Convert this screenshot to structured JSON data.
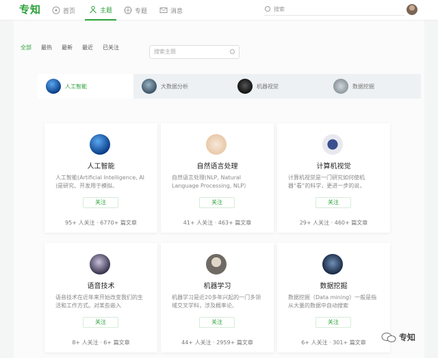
{
  "header": {
    "logo": "专知",
    "nav": [
      {
        "label": "首页",
        "icon": "home-icon"
      },
      {
        "label": "主题",
        "icon": "person-icon"
      },
      {
        "label": "专题",
        "icon": "globe-icon"
      },
      {
        "label": "消息",
        "icon": "mail-icon"
      }
    ],
    "search_placeholder": "搜索"
  },
  "filters": {
    "items": [
      "全部",
      "最热",
      "最新",
      "最近",
      "已关注"
    ],
    "search_placeholder": "搜索主题"
  },
  "tabs": [
    {
      "label": "人工智能"
    },
    {
      "label": "大数据分析"
    },
    {
      "label": "机器视觉"
    },
    {
      "label": "数据挖掘"
    }
  ],
  "cards": [
    {
      "title": "人工智能",
      "desc": "人工智能(Artificial Intelligence, AI )是研究、开发用于模拟、",
      "follow": "关注",
      "stats": "95+ 人关注 · 6770+ 篇文章"
    },
    {
      "title": "自然语言处理",
      "desc": "自然语言处理(NLP, Natural Language Processing, NLP）",
      "follow": "关注",
      "stats": "41+ 人关注 · 463+ 篇文章"
    },
    {
      "title": "计算机视觉",
      "desc": "计算机视觉是一门研究如何使机器“看”的科学，更进一步的说，",
      "follow": "关注",
      "stats": "29+ 人关注 · 460+ 篇文章"
    },
    {
      "title": "语音技术",
      "desc": "语音技术在近年来开始改变我们的生活和工作方式。对某些嵌入",
      "follow": "关注",
      "stats": "8+ 人关注 · 6+ 篇文章"
    },
    {
      "title": "机器学习",
      "desc": "机器学习是近20多年兴起的一门多领域交叉学科，涉及概率论、",
      "follow": "关注",
      "stats": "44+ 人关注 · 2959+ 篇文章"
    },
    {
      "title": "数据挖掘",
      "desc": "数据挖掘（Data mining）一般是指从大量的数据中自动搜索",
      "follow": "关注",
      "stats": "6+ 人关注 · 301+ 篇文章"
    }
  ],
  "watermark": "专知",
  "colors": {
    "accent": "#2aa038"
  }
}
